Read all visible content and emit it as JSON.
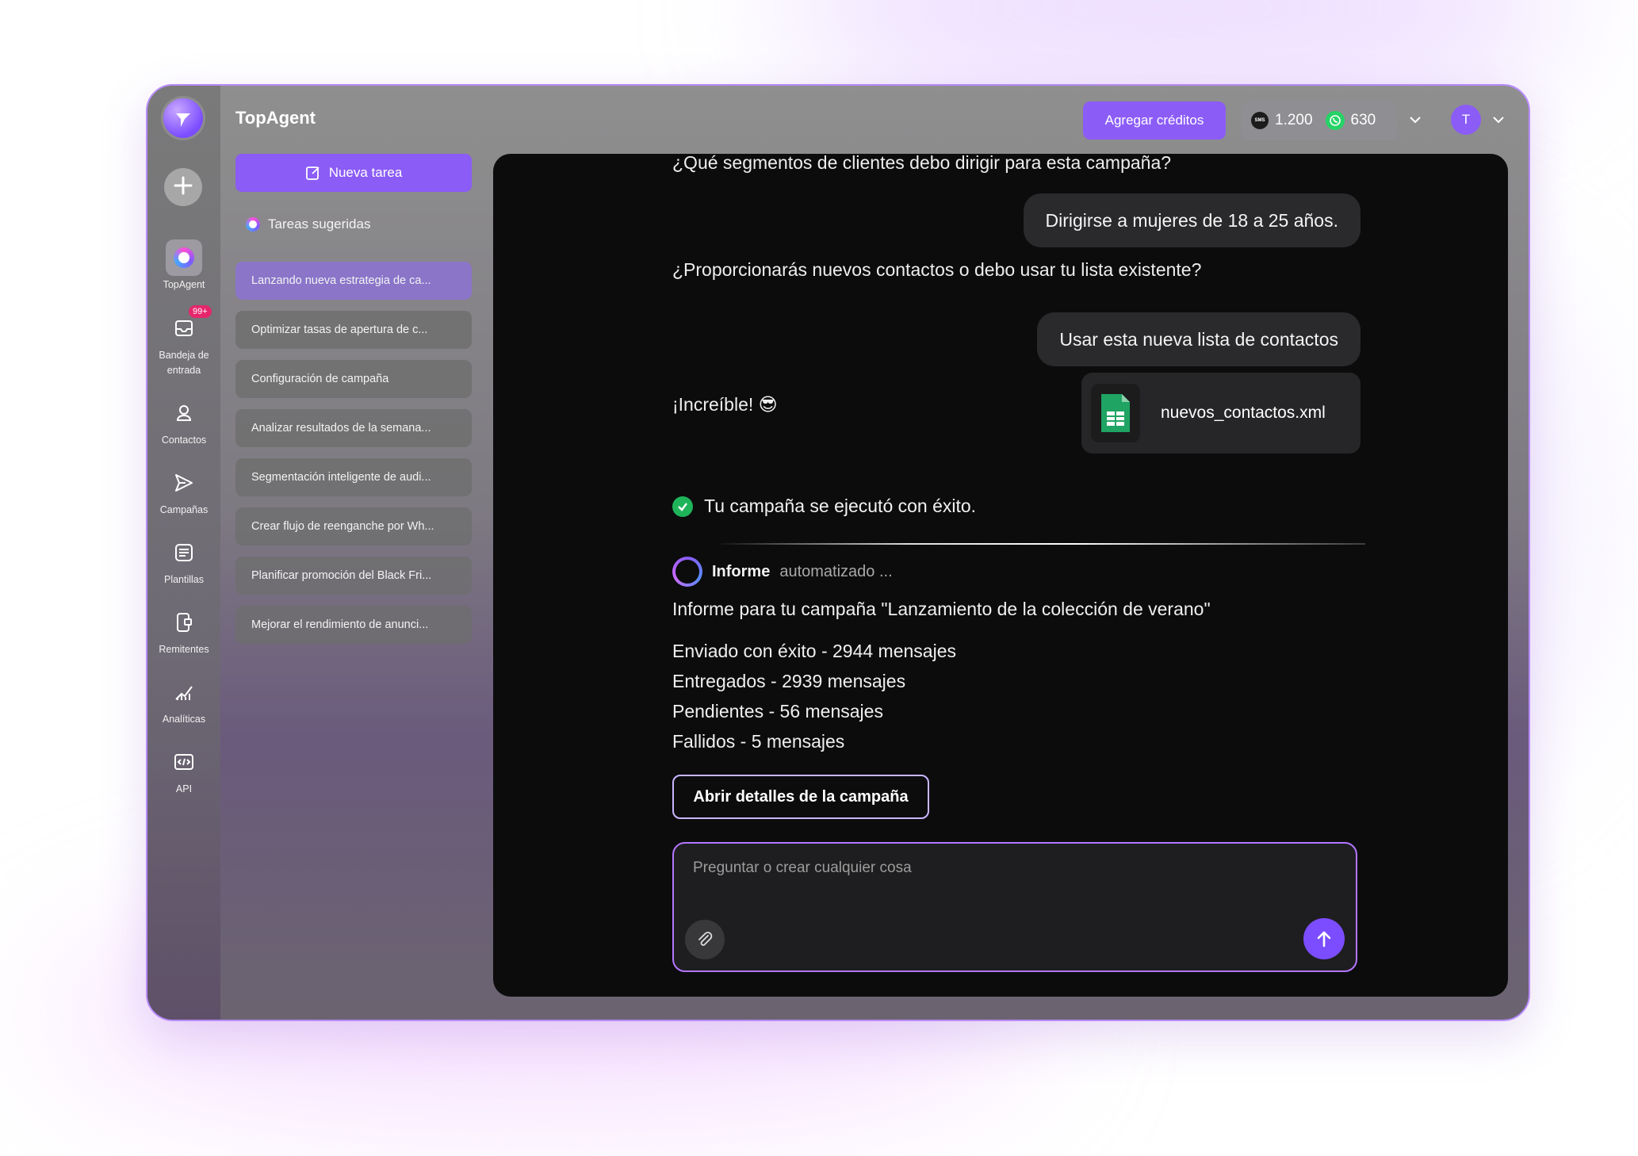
{
  "app": {
    "title": "TopAgent"
  },
  "rail": {
    "items": [
      {
        "label": "TopAgent",
        "icon": "topagent-icon"
      },
      {
        "label": "Bandeja de entrada",
        "icon": "inbox-icon",
        "badge": "99+"
      },
      {
        "label": "Contactos",
        "icon": "contact-icon"
      },
      {
        "label": "Campañas",
        "icon": "send-icon"
      },
      {
        "label": "Plantillas",
        "icon": "template-icon"
      },
      {
        "label": "Remitentes",
        "icon": "sender-icon"
      },
      {
        "label": "Analíticas",
        "icon": "analytics-icon"
      },
      {
        "label": "API",
        "icon": "api-icon"
      }
    ]
  },
  "sidebar": {
    "new_task_label": "Nueva tarea",
    "suggested_header": "Tareas sugeridas",
    "tasks": [
      "Lanzando nueva estrategia de ca...",
      "Optimizar tasas de apertura de c...",
      "Configuración de campaña",
      "Analizar resultados de la semana...",
      "Segmentación inteligente de audi...",
      "Crear flujo de reenganche por Wh...",
      "Planificar promoción del Black Fri...",
      "Mejorar el rendimiento de anunci..."
    ]
  },
  "header": {
    "credits_button": "Agregar créditos",
    "sms_balance": "1.200",
    "whatsapp_balance": "630",
    "sms_icon_text": "SMS",
    "avatar_initial": "T"
  },
  "chat": {
    "q1": "¿Qué segmentos de clientes debo dirigir para esta campaña?",
    "a1": "Dirigirse a mujeres de 18 a 25 años.",
    "q2": "¿Proporcionarás nuevos contactos o debo usar tu lista existente?",
    "a2": "Usar esta nueva lista de contactos",
    "file_name": "nuevos_contactos.xml",
    "amazing": "¡Increíble! 😎",
    "success": "Tu campaña se ejecutó con éxito.",
    "report_bold": "Informe",
    "report_status": "automatizado ...",
    "report_title": "Informe para tu campaña \"Lanzamiento de la colección de verano\"",
    "stats": [
      "Enviado con éxito - 2944 mensajes",
      "Entregados - 2939 mensajes",
      "Pendientes - 56 mensajes",
      "Fallidos - 5 mensajes"
    ],
    "open_button": "Abrir detalles de la campaña",
    "input_placeholder": "Preguntar o crear cualquier cosa"
  },
  "colors": {
    "accent": "#8b5cf6",
    "badge": "#e6266b",
    "success": "#1fb45a",
    "chat_bg": "#0c0c0d"
  }
}
